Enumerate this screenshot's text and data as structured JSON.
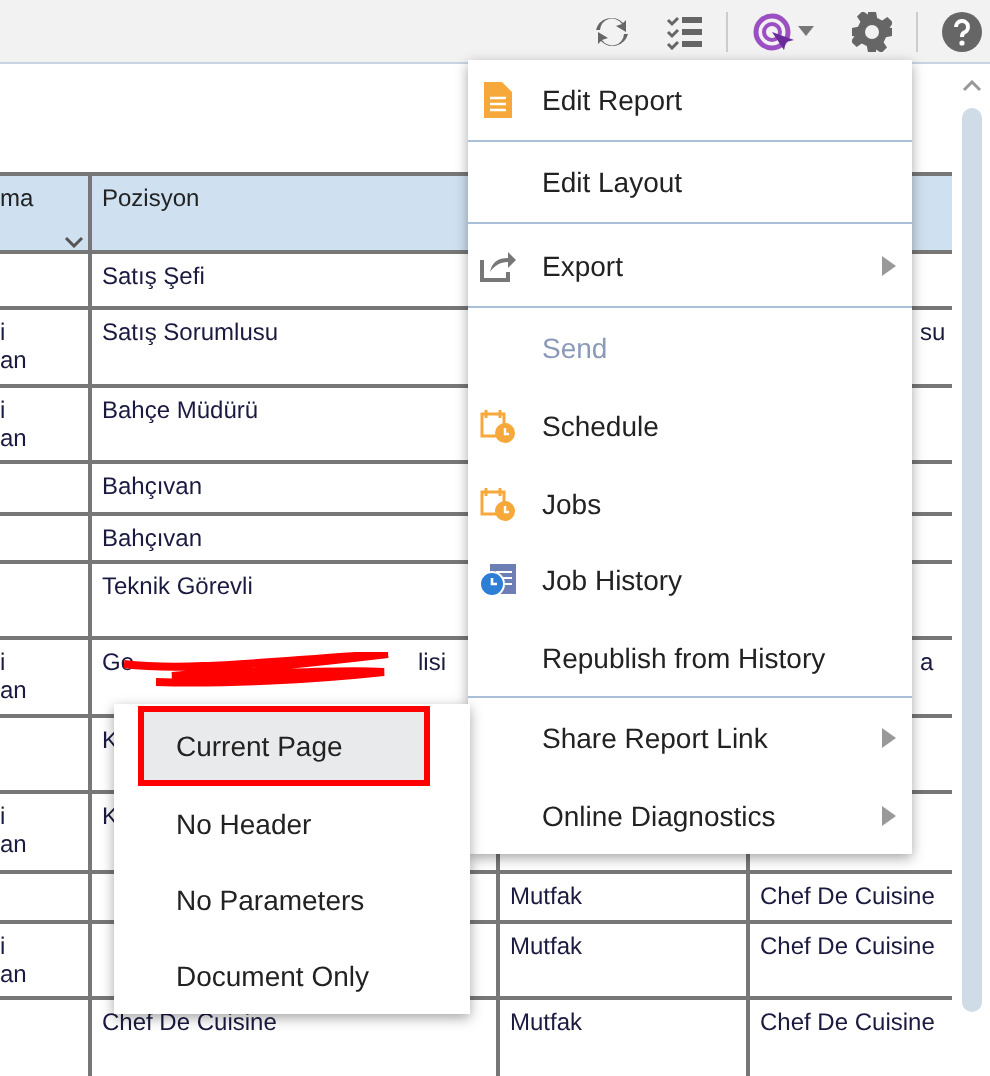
{
  "table": {
    "columns": [
      "ma",
      "Pozisyon",
      "",
      ""
    ],
    "rows": [
      {
        "c2": "Satış Şefi"
      },
      {
        "c1": "i\nan",
        "c2": "Satış Sorumlusu",
        "c4": "su"
      },
      {
        "c1": "i\nan",
        "c2": "Bahçe Müdürü"
      },
      {
        "c2": "Bahçıvan"
      },
      {
        "c2": "Bahçıvan"
      },
      {
        "c2": "Teknik Görevli"
      },
      {
        "c1": "i\nan",
        "c2": "Go",
        "c2_end": "lisi",
        "redacted": true,
        "c4": "a"
      },
      {
        "c2": "K"
      },
      {
        "c1": "i\nan",
        "c2": "K"
      },
      {
        "c3": "Mutfak",
        "c4": "Chef De Cuisine"
      },
      {
        "c1": "i\nan",
        "c3": "Mutfak",
        "c4": "Chef De Cuisine"
      },
      {
        "c2": "Chef De Cuisine",
        "c3": "Mutfak",
        "c4": "Chef De Cuisine"
      }
    ]
  },
  "menu": {
    "items": [
      {
        "label": "Edit Report",
        "disabled": false,
        "submenu": false,
        "divider_after": true
      },
      {
        "label": "Edit Layout",
        "disabled": false,
        "submenu": false,
        "divider_after": true
      },
      {
        "label": "Export",
        "disabled": false,
        "submenu": true,
        "divider_after": true
      },
      {
        "label": "Send",
        "disabled": true,
        "submenu": false,
        "divider_after": false
      },
      {
        "label": "Schedule",
        "disabled": false,
        "submenu": false,
        "divider_after": false
      },
      {
        "label": "Jobs",
        "disabled": false,
        "submenu": false,
        "divider_after": false
      },
      {
        "label": "Job History",
        "disabled": false,
        "submenu": false,
        "divider_after": false
      },
      {
        "label": "Republish from History",
        "disabled": false,
        "submenu": false,
        "divider_after": true
      },
      {
        "label": "Share Report Link",
        "disabled": false,
        "submenu": true,
        "divider_after": false
      },
      {
        "label": "Online Diagnostics",
        "disabled": false,
        "submenu": true,
        "divider_after": false
      }
    ]
  },
  "submenu": {
    "items": [
      {
        "label": "Current Page",
        "selected": true,
        "annotated": true
      },
      {
        "label": "No Header",
        "selected": false,
        "annotated": false
      },
      {
        "label": "No Parameters",
        "selected": false,
        "annotated": false
      },
      {
        "label": "Document Only",
        "selected": false,
        "annotated": false
      }
    ]
  }
}
